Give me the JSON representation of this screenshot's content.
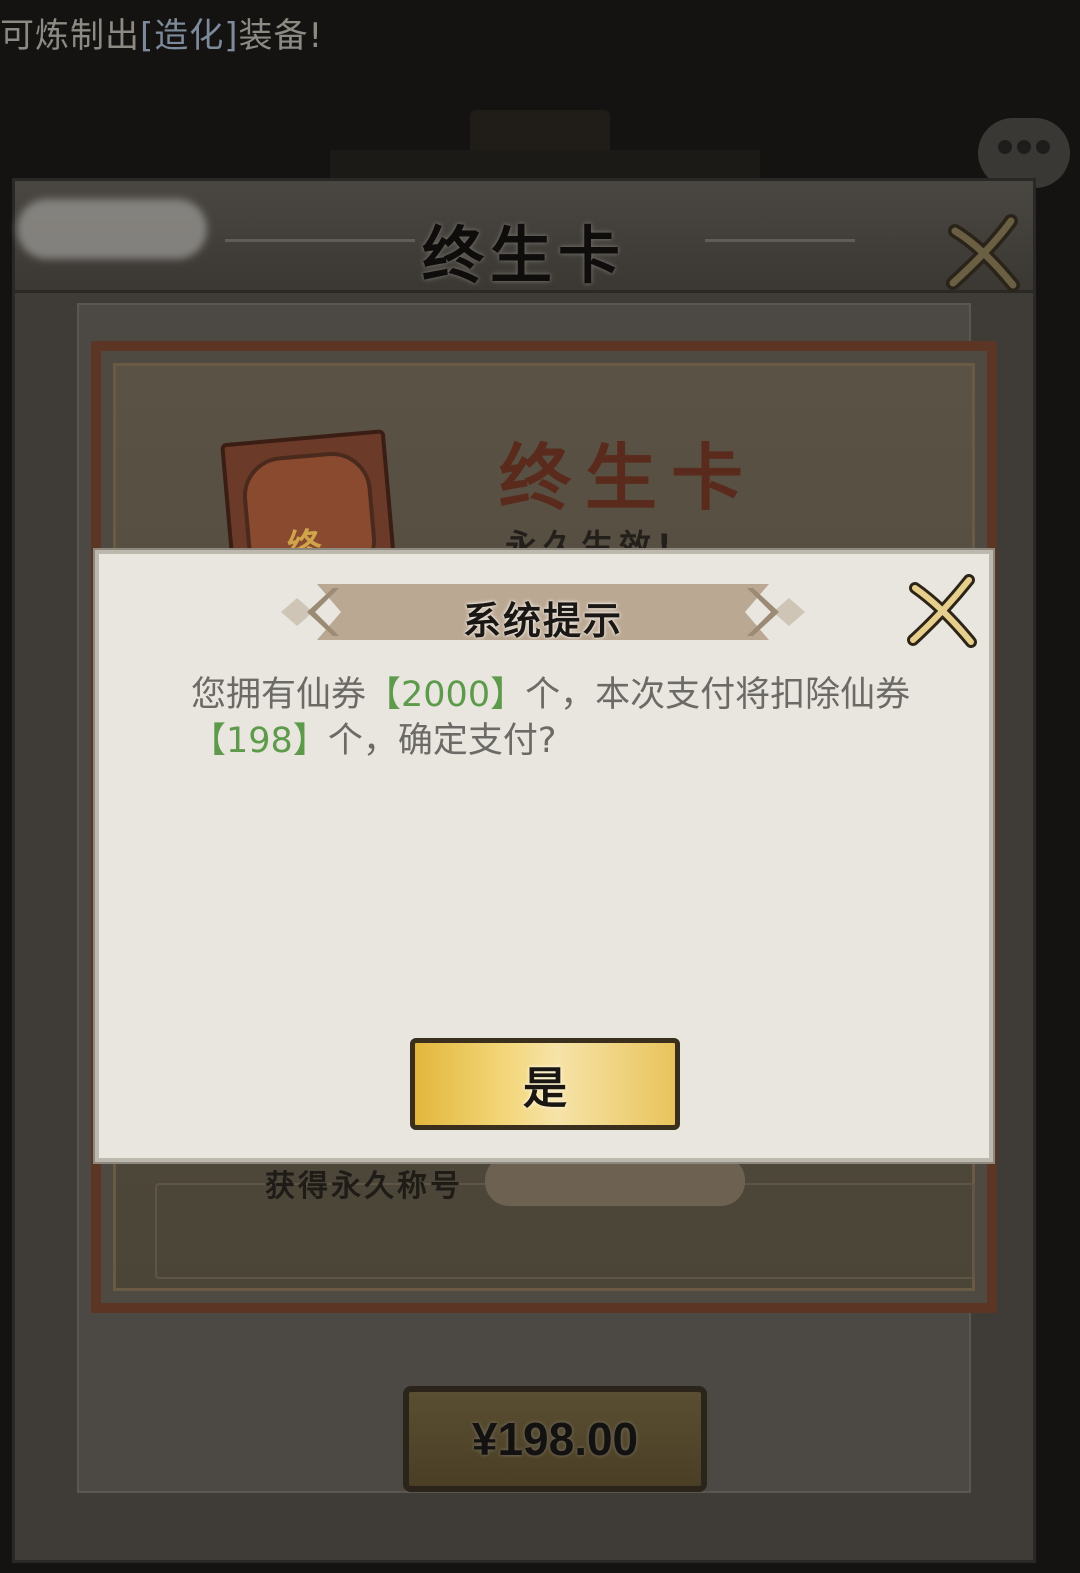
{
  "notice": {
    "prefix": "可炼制出",
    "item": "[造化]",
    "suffix": "装备!"
  },
  "card_window": {
    "title": "终生卡",
    "subtitle": "终生卡",
    "tagline": "永久生效!",
    "icon_glyph": "终",
    "benefit": "获得永久称号",
    "price_label": "¥198.00"
  },
  "dialog": {
    "title": "系统提示",
    "message_part1": "您拥有仙券",
    "owned_amount": "【2000】",
    "message_part2": "个，本次支付将扣除仙券",
    "cost_amount": "【198】",
    "message_part3": "个，确定支付?",
    "confirm_label": "是"
  },
  "colors": {
    "highlight_green": "#5d9a4b",
    "dialog_bg": "#e9e6df",
    "confirm_gold": "#f3d77a"
  },
  "icons": [
    "close-icon",
    "chat-bubble-icon",
    "card-item-icon"
  ]
}
